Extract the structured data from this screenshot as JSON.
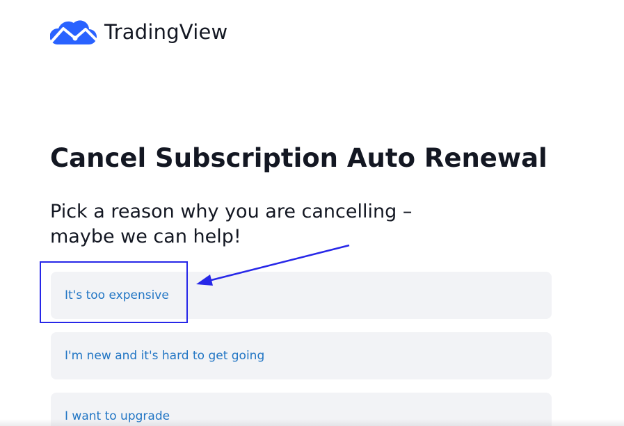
{
  "brand": {
    "name": "TradingView",
    "logo_icon": "tradingview-cloud-logo-icon",
    "logo_color": "#2962ff"
  },
  "page": {
    "title": "Cancel Subscription Auto Renewal",
    "subtitle": "Pick a reason why you are cancelling – maybe we can help!"
  },
  "reasons": [
    {
      "label": "It's too expensive"
    },
    {
      "label": "I'm new and it's hard to get going"
    },
    {
      "label": "I want to upgrade"
    }
  ],
  "annotation": {
    "highlight_color": "#2727e8",
    "arrow_icon": "arrow-pointer-icon"
  },
  "colors": {
    "text": "#131722",
    "link": "#2175c4",
    "option_background": "#f2f3f6"
  }
}
